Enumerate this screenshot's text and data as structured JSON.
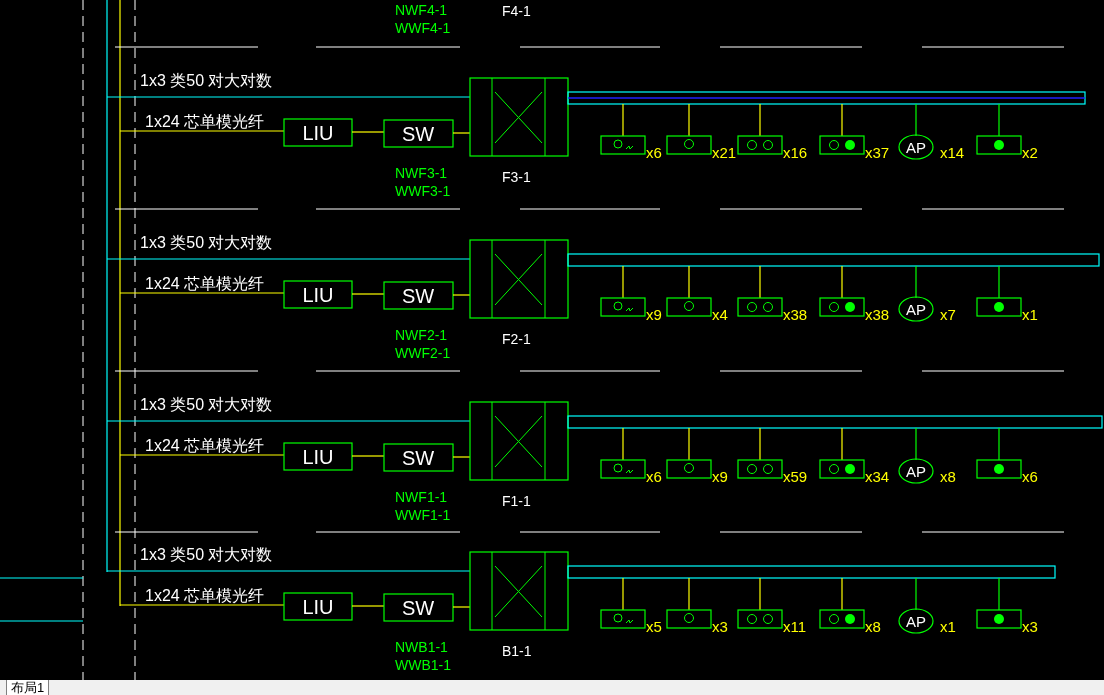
{
  "top_partial": {
    "nw": "NWF4-1",
    "ww": "WWF4-1",
    "rack_label": "F4-1"
  },
  "floors": [
    {
      "cable_copper": "1x3  类50  对大对数",
      "cable_fiber": "1x24   芯单模光纤",
      "liu": "LIU",
      "sw": "SW",
      "nw": "NWF3-1",
      "ww": "WWF3-1",
      "rack_label": "F3-1",
      "outlets": [
        {
          "kind": "voice-data",
          "count": "x6"
        },
        {
          "kind": "single",
          "count": "x21"
        },
        {
          "kind": "double",
          "count": "x16"
        },
        {
          "kind": "combo",
          "count": "x37"
        },
        {
          "kind": "ap",
          "label": "AP",
          "count": "x14"
        },
        {
          "kind": "filled",
          "count": "x2"
        }
      ]
    },
    {
      "cable_copper": "1x3  类50  对大对数",
      "cable_fiber": "1x24   芯单模光纤",
      "liu": "LIU",
      "sw": "SW",
      "nw": "NWF2-1",
      "ww": "WWF2-1",
      "rack_label": "F2-1",
      "outlets": [
        {
          "kind": "voice-data",
          "count": "x9"
        },
        {
          "kind": "single",
          "count": "x4"
        },
        {
          "kind": "double",
          "count": "x38"
        },
        {
          "kind": "combo",
          "count": "x38"
        },
        {
          "kind": "ap",
          "label": "AP",
          "count": "x7"
        },
        {
          "kind": "filled",
          "count": "x1"
        }
      ]
    },
    {
      "cable_copper": "1x3  类50  对大对数",
      "cable_fiber": "1x24   芯单模光纤",
      "liu": "LIU",
      "sw": "SW",
      "nw": "NWF1-1",
      "ww": "WWF1-1",
      "rack_label": "F1-1",
      "outlets": [
        {
          "kind": "voice-data",
          "count": "x6"
        },
        {
          "kind": "single",
          "count": "x9"
        },
        {
          "kind": "double",
          "count": "x59"
        },
        {
          "kind": "combo",
          "count": "x34"
        },
        {
          "kind": "ap",
          "label": "AP",
          "count": "x8"
        },
        {
          "kind": "filled",
          "count": "x6"
        }
      ]
    },
    {
      "cable_copper": "1x3  类50  对大对数",
      "cable_fiber": "1x24   芯单模光纤",
      "liu": "LIU",
      "sw": "SW",
      "nw": "NWB1-1",
      "ww": "WWB1-1",
      "rack_label": "B1-1",
      "outlets": [
        {
          "kind": "voice-data",
          "count": "x5"
        },
        {
          "kind": "single",
          "count": "x3"
        },
        {
          "kind": "double",
          "count": "x11"
        },
        {
          "kind": "combo",
          "count": "x8"
        },
        {
          "kind": "ap",
          "label": "AP",
          "count": "x1"
        },
        {
          "kind": "filled",
          "count": "x3"
        }
      ]
    }
  ],
  "layout_tabs": [
    {
      "label": "布局1",
      "selected": true
    }
  ]
}
